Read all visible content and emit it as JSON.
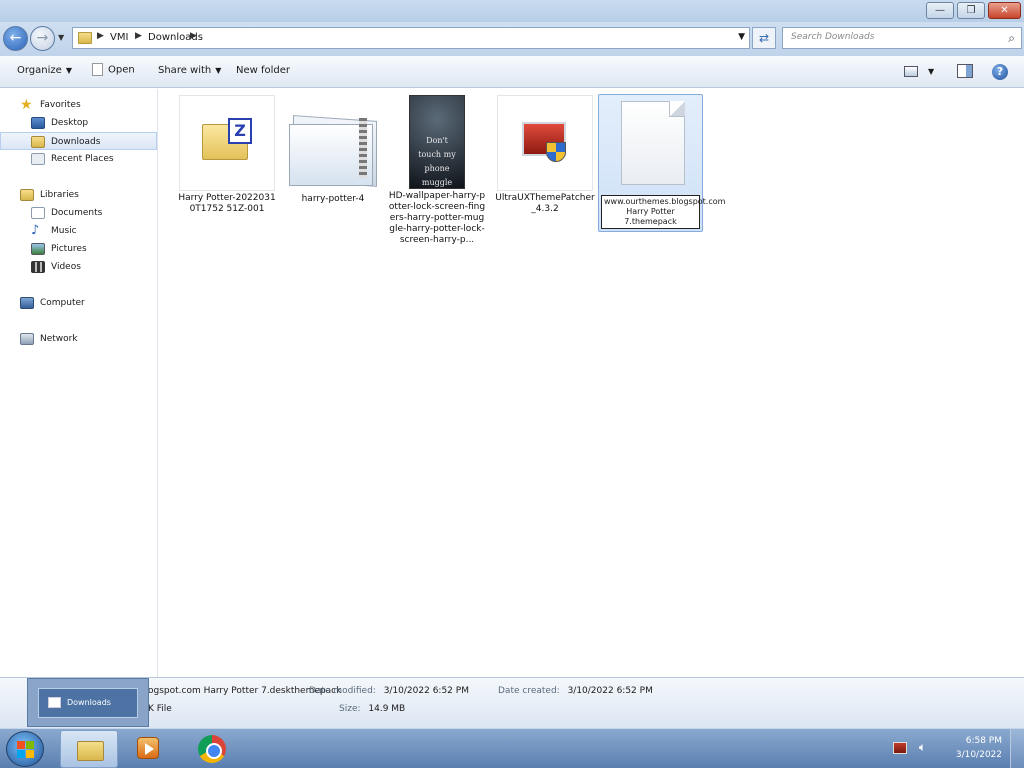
{
  "window": {
    "controls": {
      "minimize": "—",
      "maximize": "❐",
      "close": "✕"
    }
  },
  "address": {
    "segments": [
      "VMI",
      "Downloads"
    ],
    "search_placeholder": "Search Downloads"
  },
  "toolbar": {
    "organize": "Organize",
    "open": "Open",
    "share_with": "Share with",
    "new_folder": "New folder"
  },
  "sidebar": {
    "favorites": {
      "label": "Favorites",
      "items": [
        "Desktop",
        "Downloads",
        "Recent Places"
      ]
    },
    "libraries": {
      "label": "Libraries",
      "items": [
        "Documents",
        "Music",
        "Pictures",
        "Videos"
      ]
    },
    "computer": "Computer",
    "network": "Network"
  },
  "files": [
    {
      "name": "Harry Potter-20220310T1752 51Z-001",
      "icon": "zip-folder-icon"
    },
    {
      "name": "harry-potter-4",
      "icon": "zip-archive-icon"
    },
    {
      "name": "HD-wallpaper-harry-potter-lock-screen-fingers-harry-potter-muggle-harry-potter-lock-screen-harry-p...",
      "icon": "image-thumbnail",
      "thumb_text": "Don't touch my phone muggle"
    },
    {
      "name": "UltraUXThemePatcher_4.3.2",
      "icon": "installer-shield-icon"
    },
    {
      "name": "www.ourthemes.blogspot.com Harry Potter 7.themepack",
      "icon": "blank-file-icon",
      "selected": true
    }
  ],
  "details": {
    "filename": "ogspot.com Harry Potter 7.deskthemepack",
    "type": "K File",
    "date_modified_label": "Date modified:",
    "date_modified": "3/10/2022 6:52 PM",
    "date_created_label": "Date created:",
    "date_created": "3/10/2022 6:52 PM",
    "size_label": "Size:",
    "size": "14.9 MB"
  },
  "taskbar": {
    "preview_label": "Downloads",
    "time": "6:58 PM",
    "date": "3/10/2022"
  },
  "colors": {
    "accent": "#3a6bb0",
    "selection": "#cfe1f8"
  }
}
